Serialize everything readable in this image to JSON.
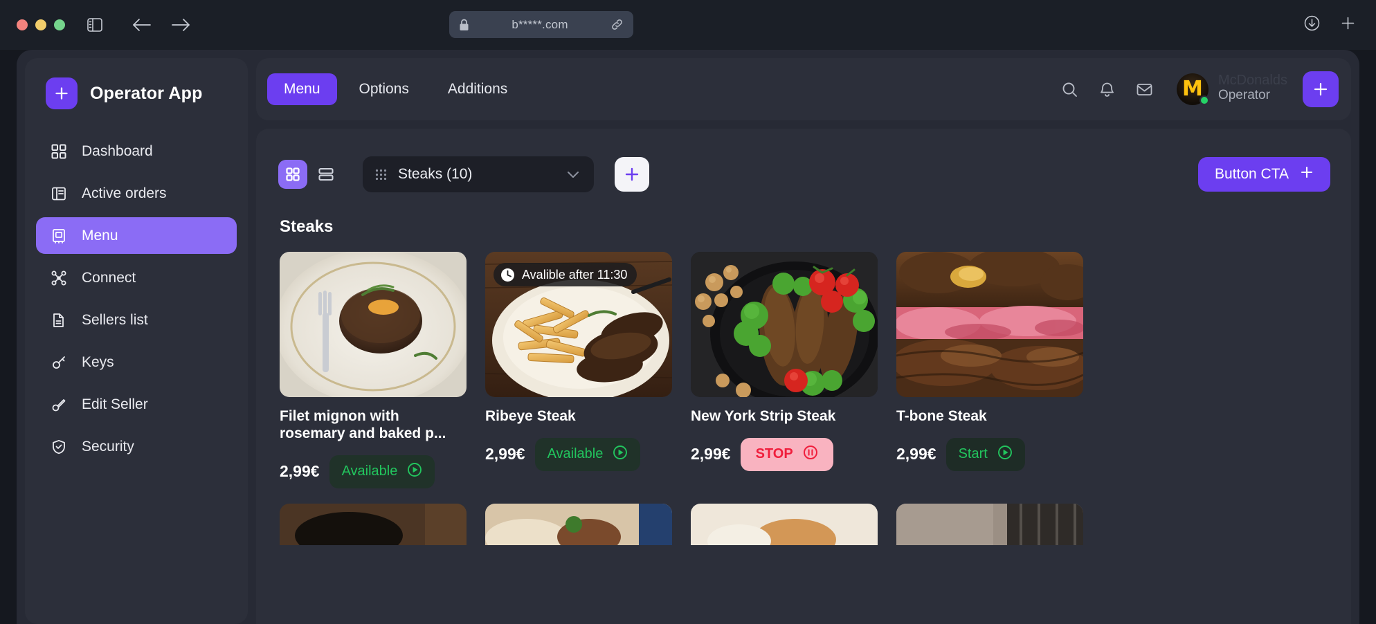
{
  "browser": {
    "url": "b*****.com",
    "lock_icon": "lock-icon",
    "link_icon": "link-icon",
    "back_icon": "arrow-left-icon",
    "forward_icon": "arrow-right-icon",
    "sidebar_icon": "sidebar-toggle-icon",
    "download_icon": "download-icon",
    "newtab_icon": "plus-icon"
  },
  "sidebar": {
    "brand": {
      "name": "Operator App",
      "badge_icon": "plus-icon"
    },
    "items": [
      {
        "label": "Dashboard",
        "icon": "grid-icon",
        "active": false
      },
      {
        "label": "Active orders",
        "icon": "book-icon",
        "active": false
      },
      {
        "label": "Menu",
        "icon": "menu-book-icon",
        "active": true
      },
      {
        "label": "Connect",
        "icon": "nodes-icon",
        "active": false
      },
      {
        "label": "Sellers list",
        "icon": "document-icon",
        "active": false
      },
      {
        "label": "Keys",
        "icon": "key-icon",
        "active": false
      },
      {
        "label": "Edit Seller",
        "icon": "pencil-icon",
        "active": false
      },
      {
        "label": "Security",
        "icon": "shield-check-icon",
        "active": false
      }
    ]
  },
  "header": {
    "tabs": [
      {
        "label": "Menu",
        "active": true
      },
      {
        "label": "Options",
        "active": false
      },
      {
        "label": "Additions",
        "active": false
      }
    ],
    "icons": [
      "search-icon",
      "bell-icon",
      "mail-icon"
    ],
    "user": {
      "org": "McDonalds",
      "role": "Operator",
      "avatar": "mcdonalds-logo-avatar",
      "status": "online"
    },
    "add_icon": "plus-icon"
  },
  "toolbar": {
    "view_grid_icon": "grid-view-icon",
    "view_list_icon": "list-view-icon",
    "category": {
      "label": "Steaks (10)",
      "grip_icon": "grip-dots-icon",
      "chevron_icon": "chevron-down-icon"
    },
    "add_icon": "plus-icon",
    "cta": {
      "label": "Button CTA",
      "icon": "plus-icon"
    }
  },
  "main": {
    "section_title": "Steaks",
    "cards": [
      {
        "title": "Filet mignon with rosemary and baked p...",
        "price": "2,99€",
        "status": {
          "label": "Available",
          "kind": "available",
          "icon": "play-circle-icon"
        },
        "badge": null
      },
      {
        "title": "Ribeye Steak",
        "price": "2,99€",
        "status": {
          "label": "Available",
          "kind": "available",
          "icon": "play-circle-icon"
        },
        "badge": {
          "label": "Avalible after 11:30",
          "icon": "clock-icon"
        }
      },
      {
        "title": "New York Strip Steak",
        "price": "2,99€",
        "status": {
          "label": "STOP",
          "kind": "stop",
          "icon": "pause-circle-icon"
        },
        "badge": null
      },
      {
        "title": "T-bone Steak",
        "price": "2,99€",
        "status": {
          "label": "Start",
          "kind": "start",
          "icon": "play-circle-icon"
        },
        "badge": null
      }
    ]
  },
  "colors": {
    "accent": "#6c3ef0",
    "accent_light": "#8b6cf5",
    "panel": "#2c2f3a",
    "app_bg": "#272a35",
    "chrome": "#1b1f27",
    "green": "#22c55e",
    "stop_bg": "#f9b3c0",
    "stop_fg": "#f01e3c"
  }
}
